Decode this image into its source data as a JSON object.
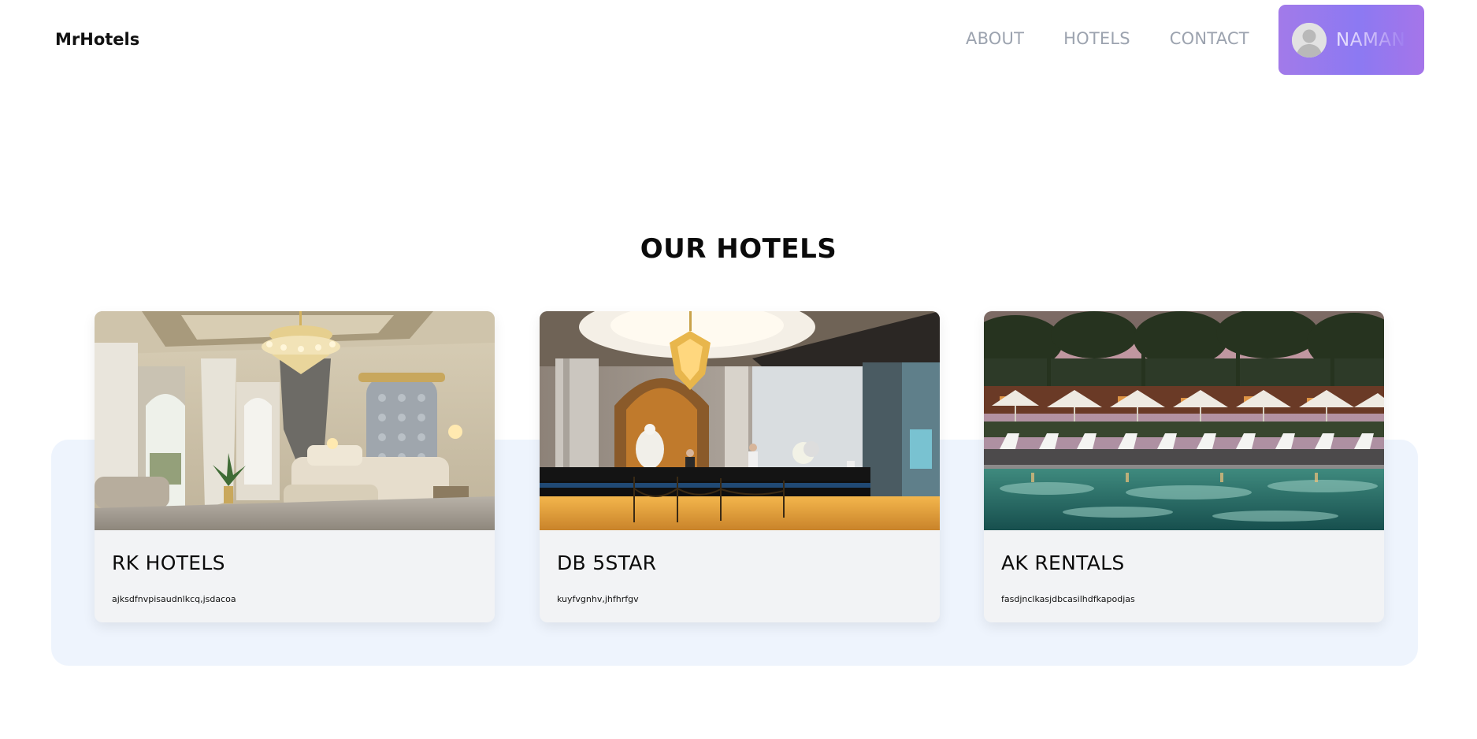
{
  "header": {
    "brand": "MrHotels",
    "nav": [
      {
        "label": "ABOUT"
      },
      {
        "label": "HOTELS"
      },
      {
        "label": "CONTACT"
      }
    ],
    "user": {
      "name": "NAMAN",
      "avatar_icon": "user-avatar-icon"
    }
  },
  "section": {
    "title": "OUR HOTELS"
  },
  "hotels": [
    {
      "name": "RK HOTELS",
      "description": "ajksdfnvpisaudnlkcq,jsdacoa",
      "image": "luxury bedroom with chandelier"
    },
    {
      "name": "DB 5STAR",
      "description": "kuyfvgnhv,jhfhrfgv",
      "image": "hotel lobby reception with chandelier"
    },
    {
      "name": "AK RENTALS",
      "description": "fasdjnclkasjdbcasilhdfkapodjas",
      "image": "resort pool with palm trees and umbrellas"
    }
  ],
  "colors": {
    "accent_gradient_start": "#a27ae9",
    "accent_gradient_end": "#8c79f2",
    "band_background": "#eef4fd",
    "card_background": "#f2f3f5",
    "nav_text": "#9ca3af"
  }
}
